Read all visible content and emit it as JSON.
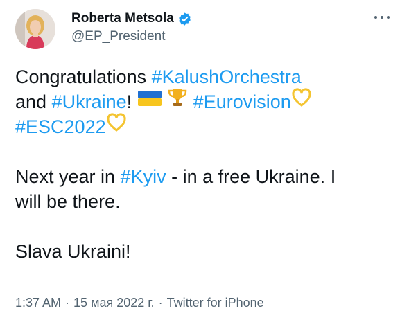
{
  "author": {
    "display_name": "Roberta Metsola",
    "handle": "@EP_President",
    "verified": true
  },
  "tweet": {
    "line1": {
      "text": "Congratulations ",
      "tag": "#KalushOrchestra"
    },
    "line2": {
      "text_a": "and ",
      "tag_a": "#Ukraine",
      "text_b": "! ",
      "tag_b": "#Eurovision",
      "emoji_a": "ukraine-flag",
      "emoji_b": "trophy",
      "emoji_c": "yellow-heart"
    },
    "line3": {
      "tag": "#ESC2022",
      "emoji": "yellow-heart"
    },
    "line4": {
      "text_a": "Next year in ",
      "tag": "#Kyiv",
      "text_b": " - in a free Ukraine. I"
    },
    "line5": "will be there.",
    "line6": "Slava Ukraini!"
  },
  "meta": {
    "time": "1:37 AM",
    "date": "15 мая 2022 г.",
    "source": "Twitter for iPhone",
    "separator": "·"
  },
  "colors": {
    "link": "#1d9bf0",
    "text": "#0f1419",
    "secondary": "#536471",
    "verified": "#1d9bf0"
  }
}
